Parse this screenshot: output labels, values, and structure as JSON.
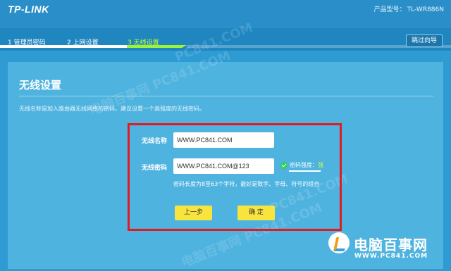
{
  "header": {
    "logo": "TP-LINK",
    "model_label": "产品型号：",
    "model_value": "TL-WR886N"
  },
  "steps": [
    {
      "label": "1 管理员密码",
      "state": "done"
    },
    {
      "label": "2 上网设置",
      "state": "done"
    },
    {
      "label": "3 无线设置",
      "state": "current"
    }
  ],
  "skip_label": "跳过向导",
  "panel": {
    "title": "无线设置",
    "description": "无线名称是加入路由器无线网络的密码，建议设置一个高强度的无线密码。"
  },
  "form": {
    "ssid_label": "无线名称",
    "ssid_value": "WWW.PC841.COM",
    "password_label": "无线密码",
    "password_value": "WWW.PC841.COM@123",
    "strength_label": "密码强度：",
    "strength_value": "强",
    "hint": "密码长度为8至63个字符，最好是数字、字母、符号的组合"
  },
  "buttons": {
    "prev": "上一步",
    "confirm": "确 定"
  },
  "watermark": {
    "brand": "电脑百事网",
    "url": "WWW.PC841.COM",
    "diag_1": "电脑百事网 PC841.COM",
    "diag_2": "PC841.COM"
  },
  "colors": {
    "background": "#2e9bd3",
    "panel": "#4fb3df",
    "highlight_border": "#e21b23",
    "button": "#f7e43d",
    "current_step": "#ccff33",
    "strength_ok": "#2fcf5e"
  }
}
